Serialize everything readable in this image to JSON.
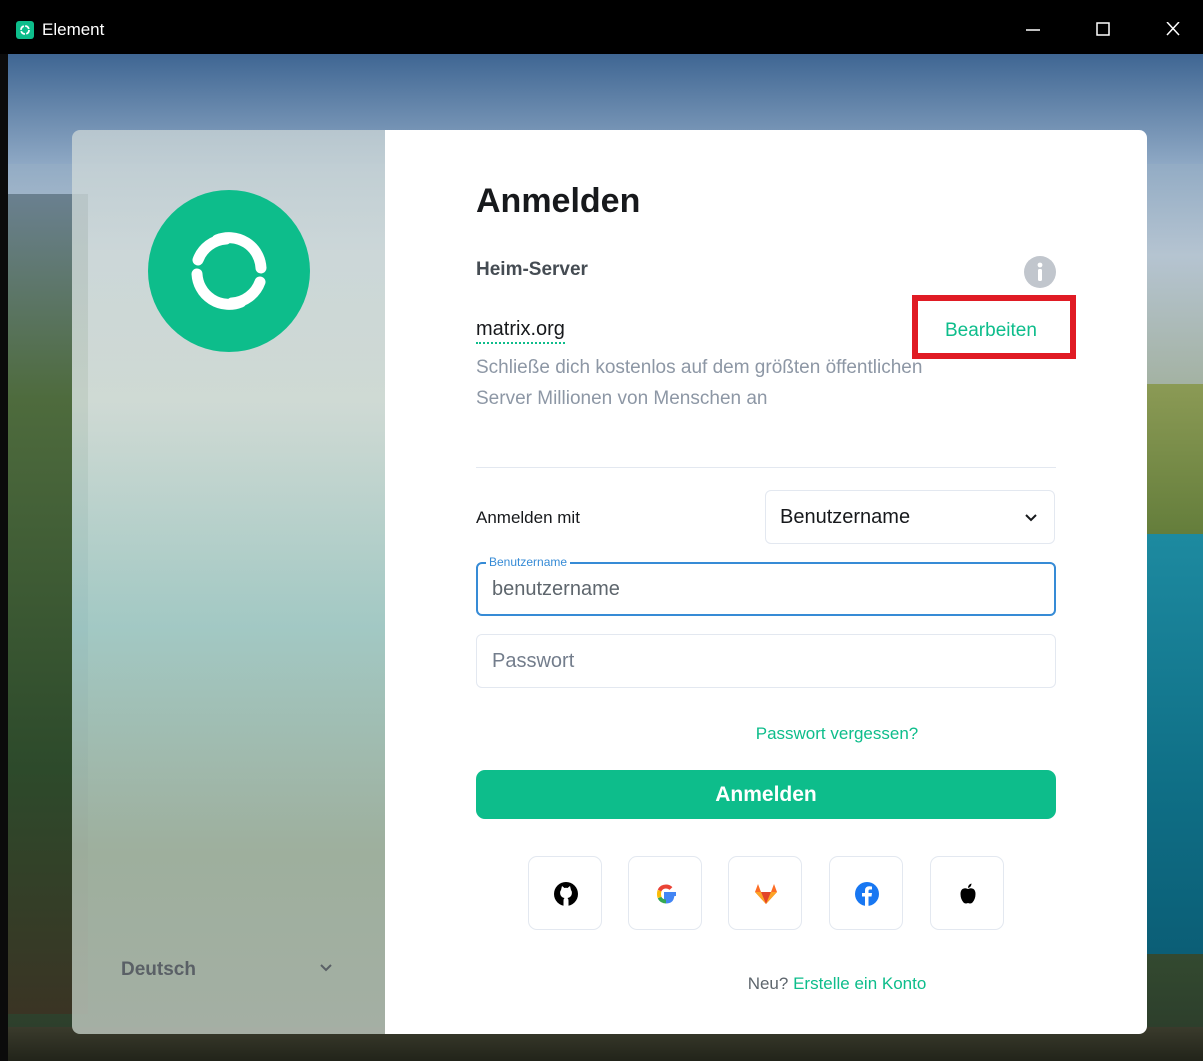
{
  "window": {
    "title": "Element",
    "icon": "element-logo-icon"
  },
  "colors": {
    "accent": "#0dbd8b",
    "highlight": "#e01b24",
    "focus": "#368bd6"
  },
  "auth": {
    "title": "Anmelden",
    "homeserver_label": "Heim-Server",
    "info_icon": "info-icon",
    "server_name": "matrix.org",
    "edit_label": "Bearbeiten",
    "server_description": "Schließe dich kostenlos auf dem größten öffentlichen Server Millionen von Menschen an",
    "login_with_label": "Anmelden mit",
    "login_with_selected": "Benutzername",
    "username_field_label": "Benutzername",
    "username_value": "benutzername",
    "password_placeholder": "Passwort",
    "forgot_password": "Passwort vergessen?",
    "submit_label": "Anmelden",
    "sso_providers": [
      "github-icon",
      "google-icon",
      "gitlab-icon",
      "facebook-icon",
      "apple-icon"
    ],
    "signup_prefix": "Neu?",
    "signup_link": "Erstelle ein Konto"
  },
  "language": {
    "selected": "Deutsch"
  }
}
